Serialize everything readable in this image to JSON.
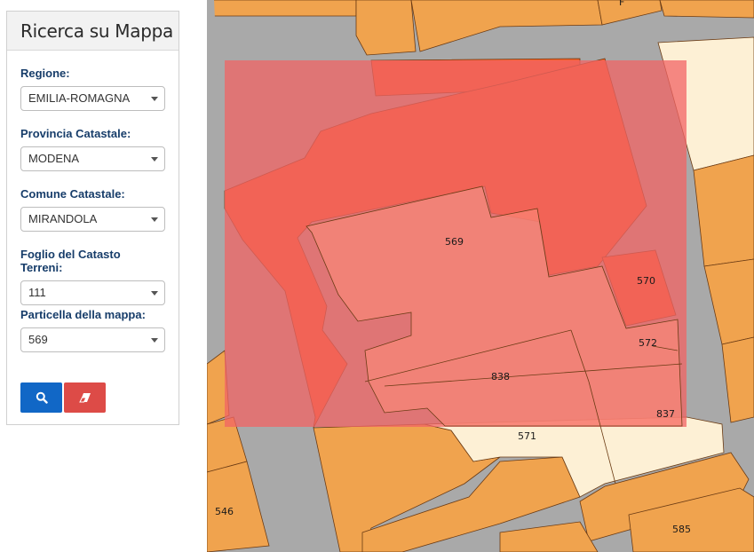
{
  "panel": {
    "title": "Ricerca su Mappa",
    "fields": [
      {
        "label": "Regione:",
        "value": "EMILIA-ROMAGNA"
      },
      {
        "label": "Provincia Catastale:",
        "value": "MODENA"
      },
      {
        "label": "Comune Catastale:",
        "value": "MIRANDOLA"
      },
      {
        "label": "Foglio del Catasto Terreni:",
        "value": "111"
      },
      {
        "label": "Particella della mappa:",
        "value": "569"
      }
    ],
    "buttons": {
      "search_icon": "search-icon",
      "clear_icon": "eraser-icon"
    }
  },
  "map": {
    "colors": {
      "street": "#a9a9a9",
      "building": "#f0a34e",
      "courtyard": "#fdf0d5",
      "selected_parcel": "#f4622c",
      "highlight_overlay": "#f26464"
    },
    "parcel_labels": [
      "569",
      "570",
      "572",
      "838",
      "837",
      "571",
      "546",
      "585",
      "F"
    ]
  }
}
